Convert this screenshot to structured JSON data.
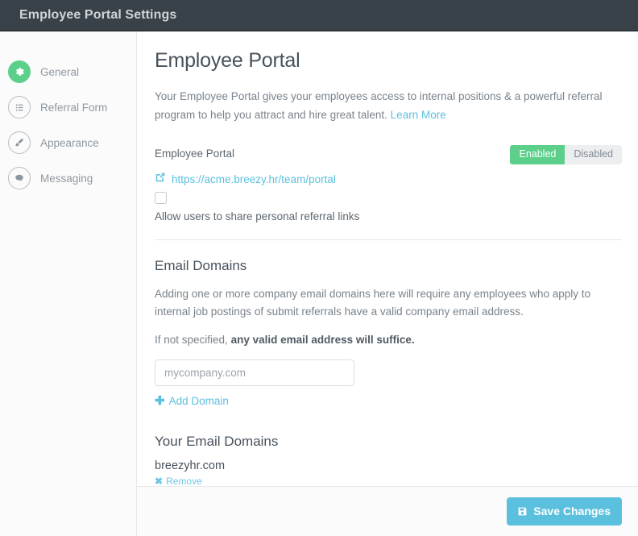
{
  "window": {
    "title": "Employee Portal Settings"
  },
  "sidebar": {
    "items": [
      {
        "label": "General",
        "icon": "gear-icon",
        "active": true
      },
      {
        "label": "Referral Form",
        "icon": "list-icon",
        "active": false
      },
      {
        "label": "Appearance",
        "icon": "paintbrush-icon",
        "active": false
      },
      {
        "label": "Messaging",
        "icon": "chat-bubble-icon",
        "active": false
      }
    ]
  },
  "main": {
    "page_title": "Employee Portal",
    "intro_text": "Your Employee Portal gives your employees access to internal positions & a powerful referral program to help you attract and hire great talent. ",
    "intro_link": "Learn More",
    "portal": {
      "label": "Employee Portal",
      "toggle_enabled_label": "Enabled",
      "toggle_disabled_label": "Disabled",
      "toggle_state": "Enabled",
      "url": "https://acme.breezy.hr/team/portal",
      "share_links_label": "Allow users to share personal referral links",
      "share_links_checked": false
    },
    "email_domains": {
      "title": "Email Domains",
      "description": "Adding one or more company email domains here will require any employees who apply to internal job postings of submit referrals have a valid company email address.",
      "note_prefix": "If not specified, ",
      "note_bold": "any valid email address will suffice.",
      "input_placeholder": "mycompany.com",
      "input_value": "",
      "add_label": "Add Domain",
      "add_glyph": "✚"
    },
    "your_domains": {
      "title": "Your Email Domains",
      "items": [
        {
          "name": "breezyhr.com",
          "remove_label": "Remove",
          "remove_glyph": "✖"
        }
      ]
    }
  },
  "footer": {
    "save_label": "Save Changes"
  },
  "colors": {
    "header_bg": "#3a4249",
    "accent_blue": "#5bc0de",
    "accent_green": "#5cd08a",
    "text_dark": "#47525d",
    "text_muted": "#79838c"
  }
}
